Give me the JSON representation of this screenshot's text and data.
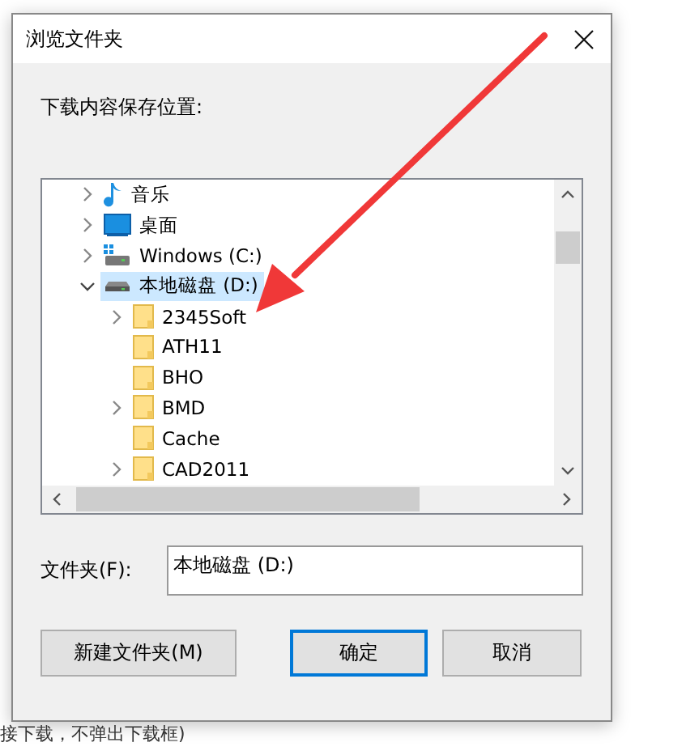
{
  "dialog": {
    "title": "浏览文件夹",
    "prompt": "下载内容保存位置:",
    "tree": [
      {
        "label": "音乐",
        "kind": "music",
        "expandable": true,
        "expanded": false,
        "selected": false
      },
      {
        "label": "桌面",
        "kind": "desktop",
        "expandable": true,
        "expanded": false,
        "selected": false
      },
      {
        "label": "Windows (C:)",
        "kind": "system-drive",
        "expandable": true,
        "expanded": false,
        "selected": false
      },
      {
        "label": "本地磁盘 (D:)",
        "kind": "drive",
        "expandable": true,
        "expanded": true,
        "selected": true,
        "children": [
          {
            "label": "2345Soft",
            "kind": "folder",
            "expandable": true,
            "expanded": false,
            "selected": false
          },
          {
            "label": "ATH11",
            "kind": "folder",
            "expandable": false,
            "selected": false
          },
          {
            "label": "BHO",
            "kind": "folder",
            "expandable": false,
            "selected": false
          },
          {
            "label": "BMD",
            "kind": "folder",
            "expandable": true,
            "expanded": false,
            "selected": false
          },
          {
            "label": "Cache",
            "kind": "folder",
            "expandable": false,
            "selected": false
          },
          {
            "label": "CAD2011",
            "kind": "folder",
            "expandable": true,
            "expanded": false,
            "selected": false
          }
        ]
      }
    ],
    "folder_label": "文件夹(F):",
    "folder_value": "本地磁盘 (D:)",
    "buttons": [
      {
        "label": "新建文件夹(M)",
        "default": false
      },
      {
        "label": "确定",
        "default": true
      },
      {
        "label": "取消",
        "default": false
      }
    ]
  },
  "background_text": "接下载，不弹出下载框)"
}
